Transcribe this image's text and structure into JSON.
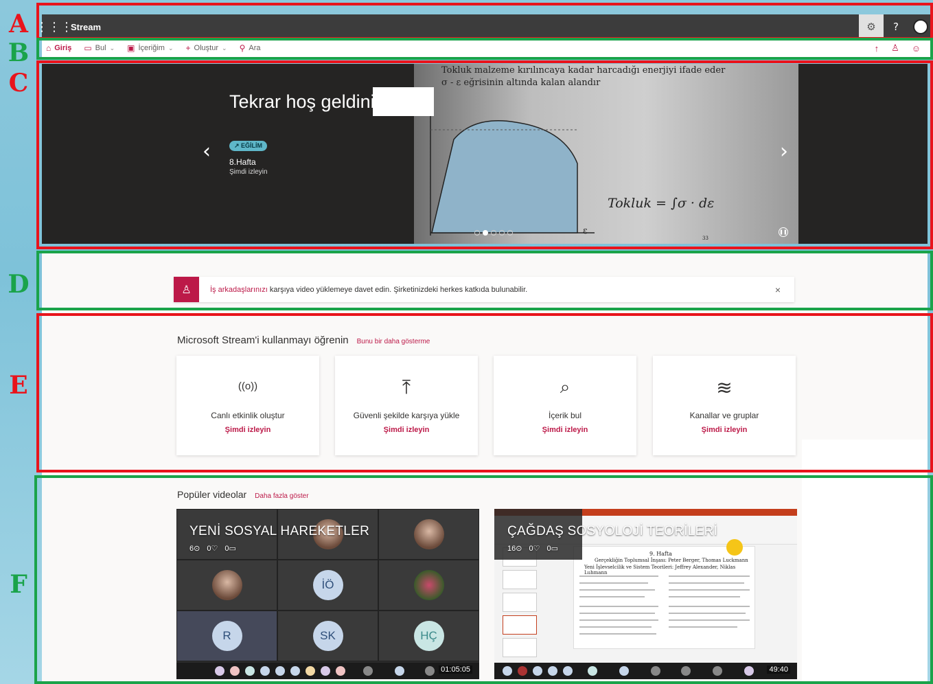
{
  "annotations": {
    "letters": [
      "A",
      "B",
      "C",
      "D",
      "E",
      "F"
    ]
  },
  "topbar": {
    "app_title": "Stream",
    "waffle_icon": "waffle-icon",
    "settings_icon": "gear-icon",
    "help_label": "?"
  },
  "nav": {
    "items": [
      {
        "label": "Giriş",
        "icon": "home-icon"
      },
      {
        "label": "Bul",
        "icon": "find-icon"
      },
      {
        "label": "İçeriğim",
        "icon": "my-content-icon"
      },
      {
        "label": "Oluştur",
        "icon": "plus-icon"
      }
    ],
    "search_label": "Ara",
    "accent": "#bc1948"
  },
  "hero": {
    "welcome": "Tekrar hoş geldiniz",
    "tag": "EĞİLİM",
    "title": "8.Hafta",
    "subtitle": "Şimdi izleyin",
    "slide_text_1": "Tokluk malzeme kırılıncaya kadar harcadığı enerjiyi ifade eder",
    "slide_text_2": "σ - ε eğrisinin altında kalan alandır",
    "slide_formula": "Tokluk = ∫σ · dε",
    "slide_axis": "ε",
    "slide_page": "33",
    "dots_total": 5,
    "dots_active": 1
  },
  "invite": {
    "link_text": "İş arkadaşlarınızı",
    "text": " karşıya video yüklemeye davet edin. Şirketinizdeki herkes katkıda bulunabilir.",
    "close": "×"
  },
  "learn": {
    "title": "Microsoft Stream'i kullanmayı öğrenin",
    "dismiss": "Bunu bir daha gösterme",
    "cards": [
      {
        "icon": "live-event-icon",
        "glyph": "((o))",
        "label": "Canlı etkinlik oluştur",
        "link": "Şimdi izleyin"
      },
      {
        "icon": "upload-icon",
        "glyph": "⤒",
        "label": "Güvenli şekilde karşıya yükle",
        "link": "Şimdi izleyin"
      },
      {
        "icon": "discover-icon",
        "glyph": "⌕",
        "label": "İçerik bul",
        "link": "Şimdi izleyin"
      },
      {
        "icon": "channels-icon",
        "glyph": "≋",
        "label": "Kanallar ve gruplar",
        "link": "Şimdi izleyin"
      }
    ]
  },
  "popular": {
    "title": "Popüler videolar",
    "more": "Daha fazla göster",
    "videos": [
      {
        "title": "YENİ SOSYAL HAREKETLER",
        "views": "6",
        "likes": "0",
        "comments": "0",
        "duration": "01:05:05",
        "tiles": [
          "",
          "",
          "",
          "",
          "İÖ",
          "",
          "R",
          "SK",
          "HÇ"
        ]
      },
      {
        "title": "ÇAĞDAŞ SOSYOLOJİ TEORİLERİ",
        "views": "16",
        "likes": "0",
        "comments": "0",
        "duration": "49:40",
        "doc_week": "9. Hafta",
        "doc_line_1": "Gerçekliğin Toplumsal İnşası: Peter Berger, Thomas Luckmann",
        "doc_line_2": "Yeni İşlevselcilik ve Sistem Teorileri: Jeffrey Alexander, Niklas Luhmann"
      }
    ]
  }
}
